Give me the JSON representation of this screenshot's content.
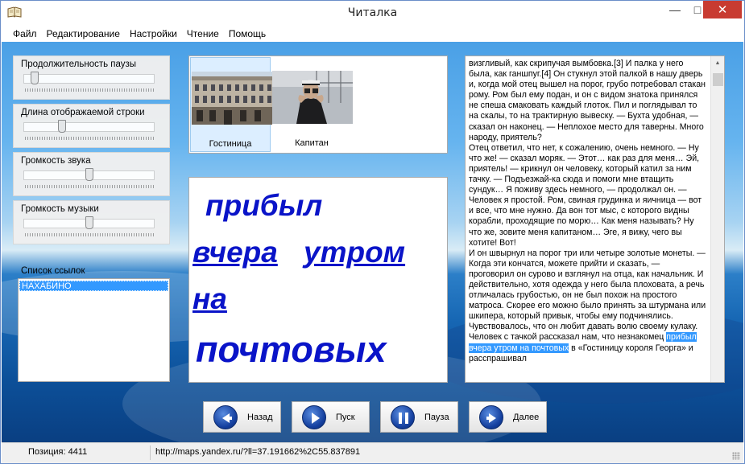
{
  "window": {
    "title": "Читалка",
    "controls": {
      "minimize": "—",
      "maximize": "□",
      "close": "✕"
    }
  },
  "menu": [
    "Файл",
    "Редактирование",
    "Настройки",
    "Чтение",
    "Помощь"
  ],
  "sliders": [
    {
      "label": "Продолжительность паузы",
      "value": 0.05
    },
    {
      "label": "Длина отображаемой строки",
      "value": 0.28
    },
    {
      "label": "Громкость звука",
      "value": 0.5
    },
    {
      "label": "Громкость музыки",
      "value": 0.5
    }
  ],
  "links": {
    "label": "Список ссылок",
    "items": [
      "НАХАБИНО"
    ]
  },
  "images": [
    {
      "caption": "Гостиница",
      "selected": true
    },
    {
      "caption": "Капитан",
      "selected": false
    }
  ],
  "big_words": [
    "прибыл",
    "вчера",
    "утром",
    "на",
    "почтовых"
  ],
  "text": {
    "before": "визгливый, как скрипучая вымбовка.[3] И палка у него была, как ганшпуг.[4] Он стукнул этой палкой в нашу дверь и, когда мой отец вышел на порог, грубо потребовал стакан рому. Ром был ему подан, и он с видом знатока принялся не спеша смаковать каждый глоток. Пил и поглядывал то на скалы, то на трактирную вывеску. — Бухта удобная, — сказал он наконец. — Неплохое место для таверны. Много народу, приятель?\nОтец ответил, что нет, к сожалению, очень немного. — Ну что же! — сказал моряк. — Этот… как раз для меня… Эй, приятель! — крикнул он человеку, который катил за ним тачку. — Подъезжай-ка сюда и помоги мне втащить сундук… Я поживу здесь немного, — продолжал он. — Человек я простой. Ром, свиная грудинка и яичница — вот и все, что мне нужно. Да вон тот мыс, с которого видны корабли, проходящие по морю… Как меня называть? Ну что же, зовите меня капитаном… Эге, я вижу, чего вы хотите! Вот!\nИ он швырнул на порог три или четыре золотые монеты. — Когда эти кончатся, можете прийти и сказать, — проговорил он сурово и взглянул на отца, как начальник. И действительно, хотя одежда у него была плоховата, а речь отличалась грубостью, он не был похож на простого матроса. Скорее его можно было принять за штурмана или шкипера, который привык, чтобы ему подчинялись. Чувствовалось, что он любит давать волю своему кулаку. Человек с тачкой рассказал нам, что незнакомец ",
    "highlight": "прибыл вчера утром на почтовых",
    "after": " в «Гостиницу короля Георга» и расспрашивал"
  },
  "buttons": [
    {
      "label": "Назад",
      "icon": "back-arrow-icon"
    },
    {
      "label": "Пуск",
      "icon": "play-icon"
    },
    {
      "label": "Пауза",
      "icon": "pause-icon"
    },
    {
      "label": "Далее",
      "icon": "forward-arrow-icon"
    }
  ],
  "status": {
    "position": "Позиция: 4411",
    "url": "http://maps.yandex.ru/?ll=37.191662%2C55.837891"
  },
  "colors": {
    "accent": "#3399ff",
    "big_word": "#0a14c8",
    "close_button": "#c83b31"
  }
}
